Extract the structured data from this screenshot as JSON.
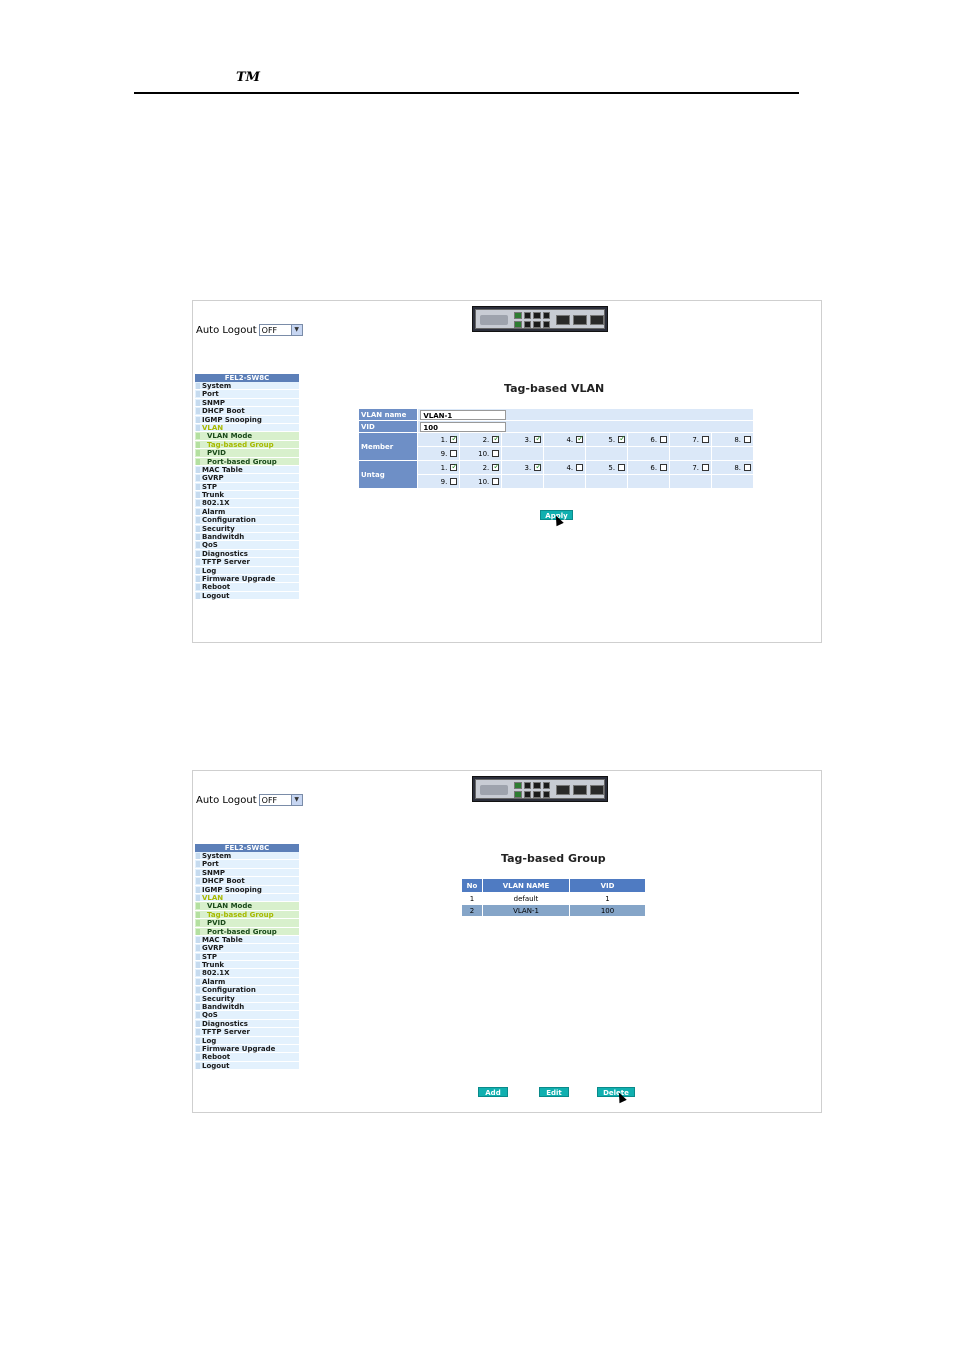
{
  "doc": {
    "tm": "TM"
  },
  "common": {
    "auto_logout_label": "Auto Logout",
    "auto_logout_value": "OFF",
    "menu_title": "FEL2-SW8C",
    "menu": [
      {
        "label": "System",
        "type": "item"
      },
      {
        "label": "Port",
        "type": "item"
      },
      {
        "label": "SNMP",
        "type": "item"
      },
      {
        "label": "DHCP Boot",
        "type": "item"
      },
      {
        "label": "IGMP Snooping",
        "type": "item"
      },
      {
        "label": "VLAN",
        "type": "item",
        "active": true
      },
      {
        "label": "VLAN Mode",
        "type": "sub"
      },
      {
        "label": "Tag-based Group",
        "type": "sub",
        "active": true
      },
      {
        "label": "PVID",
        "type": "sub"
      },
      {
        "label": "Port-based Group",
        "type": "sub"
      },
      {
        "label": "MAC Table",
        "type": "item"
      },
      {
        "label": "GVRP",
        "type": "item"
      },
      {
        "label": "STP",
        "type": "item"
      },
      {
        "label": "Trunk",
        "type": "item"
      },
      {
        "label": "802.1X",
        "type": "item"
      },
      {
        "label": "Alarm",
        "type": "item"
      },
      {
        "label": "Configuration",
        "type": "item"
      },
      {
        "label": "Security",
        "type": "item"
      },
      {
        "label": "Bandwitdh",
        "type": "item"
      },
      {
        "label": "QoS",
        "type": "item"
      },
      {
        "label": "Diagnostics",
        "type": "item"
      },
      {
        "label": "TFTP Server",
        "type": "item"
      },
      {
        "label": "Log",
        "type": "item"
      },
      {
        "label": "Firmware Upgrade",
        "type": "item"
      },
      {
        "label": "Reboot",
        "type": "item"
      },
      {
        "label": "Logout",
        "type": "item"
      }
    ]
  },
  "screen1": {
    "title": "Tag-based VLAN",
    "vlan_name_label": "VLAN name",
    "vlan_name_value": "VLAN-1",
    "vid_label": "VID",
    "vid_value": "100",
    "member_label": "Member",
    "untag_label": "Untag",
    "member_ports": [
      {
        "n": "1.",
        "checked": true
      },
      {
        "n": "2.",
        "checked": true
      },
      {
        "n": "3.",
        "checked": true
      },
      {
        "n": "4.",
        "checked": true
      },
      {
        "n": "5.",
        "checked": true
      },
      {
        "n": "6.",
        "checked": false
      },
      {
        "n": "7.",
        "checked": false
      },
      {
        "n": "8.",
        "checked": false
      },
      {
        "n": "9.",
        "checked": false
      },
      {
        "n": "10.",
        "checked": false
      }
    ],
    "untag_ports": [
      {
        "n": "1.",
        "checked": true
      },
      {
        "n": "2.",
        "checked": true
      },
      {
        "n": "3.",
        "checked": true
      },
      {
        "n": "4.",
        "checked": false
      },
      {
        "n": "5.",
        "checked": false
      },
      {
        "n": "6.",
        "checked": false
      },
      {
        "n": "7.",
        "checked": false
      },
      {
        "n": "8.",
        "checked": false
      },
      {
        "n": "9.",
        "checked": false
      },
      {
        "n": "10.",
        "checked": false
      }
    ],
    "apply_label": "Apply"
  },
  "screen2": {
    "title": "Tag-based Group",
    "columns": [
      "No",
      "VLAN NAME",
      "VID"
    ],
    "rows": [
      {
        "no": "1",
        "name": "default",
        "vid": "1",
        "selected": false
      },
      {
        "no": "2",
        "name": "VLAN-1",
        "vid": "100",
        "selected": true
      }
    ],
    "add_label": "Add",
    "edit_label": "Edit",
    "delete_label": "Delete"
  }
}
